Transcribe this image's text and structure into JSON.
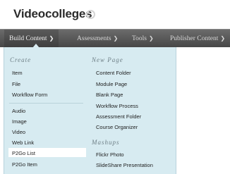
{
  "header": {
    "title": "Videocolleges"
  },
  "menubar": {
    "tabs": [
      {
        "label": "Build Content"
      },
      {
        "label": "Assessments"
      },
      {
        "label": "Tools"
      },
      {
        "label": "Publisher Content"
      }
    ]
  },
  "dropdown": {
    "create_heading": "Create",
    "create_items": [
      "Item",
      "File",
      "Workflow Form",
      "Audio",
      "Image",
      "Video",
      "Web Link",
      "P2Go List",
      "P2Go Item"
    ],
    "new_page_heading": "New Page",
    "new_page_items": [
      "Content Folder",
      "Module Page",
      "Blank Page",
      "Workflow Process",
      "Assessment Folder",
      "Course Organizer"
    ],
    "mashups_heading": "Mashups",
    "mashups_items": [
      "Flickr Photo",
      "SlideShare Presentation"
    ],
    "highlighted_item": "P2Go List"
  }
}
